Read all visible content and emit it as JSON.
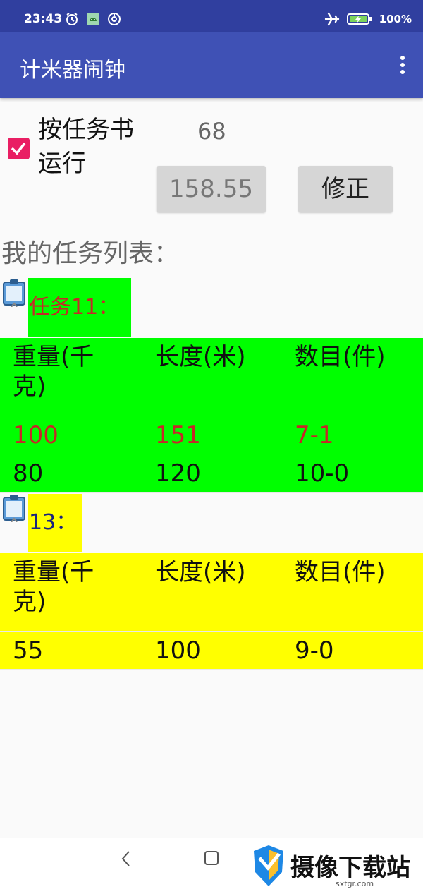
{
  "status_bar": {
    "time": "23:43",
    "battery": "100%"
  },
  "app_bar": {
    "title": "计米器闹钟"
  },
  "controls": {
    "run_by_task_label": "按任务书运行",
    "run_by_task_checked": true,
    "count": "68",
    "value_button": "158.55",
    "fix_button": "修正"
  },
  "list_heading": "我的任务列表：",
  "tasks": [
    {
      "title": "任务11：",
      "background": "#00ff00",
      "title_color": "#c62828",
      "headers": [
        "重量(千克)",
        "长度(米)",
        "数目(件)"
      ],
      "rows": [
        {
          "weight": "100",
          "length": "151",
          "count": "7-1",
          "color": "#c62828"
        },
        {
          "weight": "80",
          "length": "120",
          "count": "10-0",
          "color": "#000000"
        }
      ]
    },
    {
      "title": "13：",
      "background": "#ffff00",
      "title_color": "#1a237e",
      "headers": [
        "重量(千克)",
        "长度(米)",
        "数目(件)"
      ],
      "rows": [
        {
          "weight": "55",
          "length": "100",
          "count": "9-0",
          "color": "#000000"
        }
      ]
    }
  ],
  "watermark": {
    "text": "摄像下载站",
    "sub": "sxtgr.com"
  },
  "colors": {
    "status_bar": "#303f9f",
    "app_bar": "#3f51b5",
    "accent": "#e91e63"
  }
}
